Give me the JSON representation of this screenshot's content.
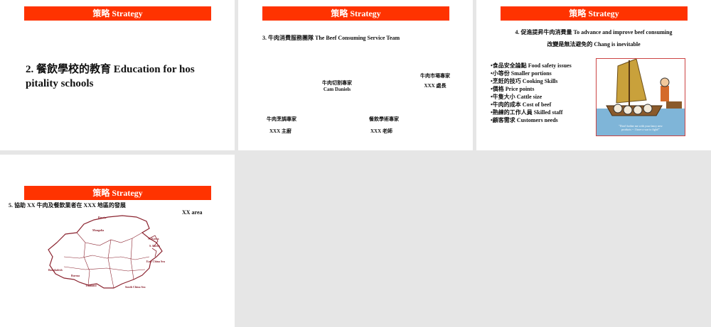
{
  "banner_title": "策略 Strategy",
  "slide1": {
    "heading_line1": "2.  餐飲學校的教育  Education for hos",
    "heading_line2": "pitality schools"
  },
  "slide2": {
    "title": "3.   牛肉消費服務團隊  The Beef Consuming Service Team",
    "cutting_title": "牛肉切割專家",
    "cutting_name": "Cam Daniels",
    "market_title": "牛肉市場專家",
    "market_name": "XXX    處長",
    "cooking_title": "牛肉烹調專家",
    "cooking_name": "XXX    主廚",
    "art_title": "餐飲學術專家",
    "art_name": "XXX    老師"
  },
  "slide3": {
    "title_line1": "4.  促進提昇牛肉消費量  To advance and improve beef consuming",
    "title_line2": "改變是無法避免的  Chang is inevitable",
    "bullets": [
      "•食品安全論點  Food safety issues",
      "•小等份  Smaller portions",
      "•烹飪的技巧  Cooking Skills",
      "•價格  Price points",
      "•牛隻大小  Cattle size",
      "•牛肉的成本  Cost of beef",
      "•熟練的工作人員  Skilled staff",
      "•顧客需求  Customers needs"
    ],
    "caption_line1": "\"Don't bother me with your fancy new",
    "caption_line2": "products -- I have a war to fight!\""
  },
  "slide4": {
    "title": "5.  協助 XX 牛肉及餐飲業者在 XXX 地區的發展",
    "area_label": "XX area",
    "map_labels": {
      "russia": "Russia",
      "mongolia": "Mongolia",
      "n_korea": "N. Korea",
      "s_korea": "S. Korea",
      "east_china_sea": "East China Sea",
      "bangladesh": "Bangladesh",
      "burma": "Burma",
      "thailand": "Thailand",
      "south_china_sea": "South China Sea"
    }
  },
  "colors": {
    "banner": "#ff3300",
    "map_line": "#8b2430",
    "sail": "#c9a13b",
    "sea": "#7fb5d8"
  }
}
